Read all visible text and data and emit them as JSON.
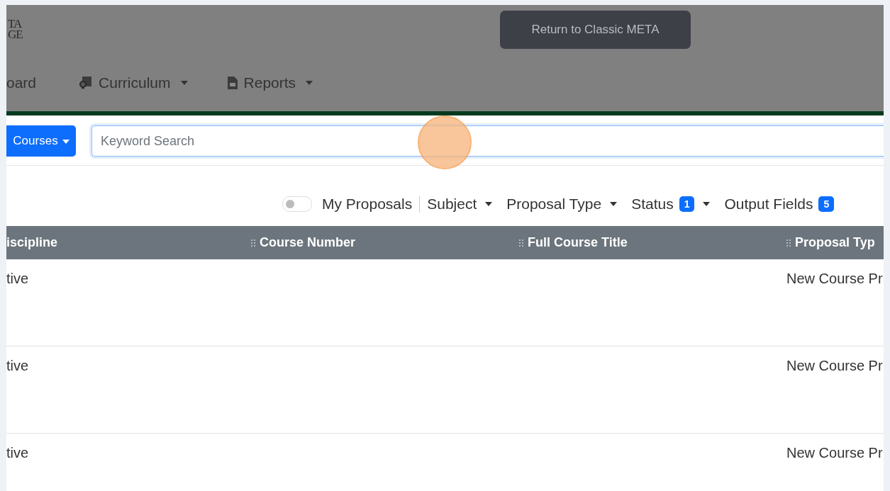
{
  "header": {
    "logo_lines": [
      "TA",
      "GE"
    ],
    "classic_button": "Return to Classic META",
    "nav": [
      {
        "label": "oard",
        "kind": "plain",
        "dropdown": false
      },
      {
        "label": "Curriculum",
        "kind": "certificate",
        "dropdown": true
      },
      {
        "label": "Reports",
        "kind": "document",
        "dropdown": true
      }
    ]
  },
  "search": {
    "scope_button": "Courses",
    "placeholder": "Keyword Search"
  },
  "filters": {
    "my_proposals": {
      "label": "My Proposals",
      "on": false
    },
    "dropdowns": [
      {
        "label": "Subject"
      },
      {
        "label": "Proposal Type"
      },
      {
        "label": "Status",
        "badge": "1"
      },
      {
        "label": "Output Fields",
        "badge": "5",
        "caret": false
      }
    ]
  },
  "table": {
    "columns": [
      {
        "label": "iscipline",
        "grip": false
      },
      {
        "label": "Course Number",
        "grip": true
      },
      {
        "label": "Full Course Title",
        "grip": true
      },
      {
        "label": "Proposal Typ",
        "grip": true
      }
    ],
    "rows": [
      {
        "column_1": "tive",
        "column_4": "New Course Pr"
      },
      {
        "column_1": "tive",
        "column_4": "New Course Pr"
      },
      {
        "column_1": "tive",
        "column_4": "New Course Pr"
      }
    ]
  }
}
